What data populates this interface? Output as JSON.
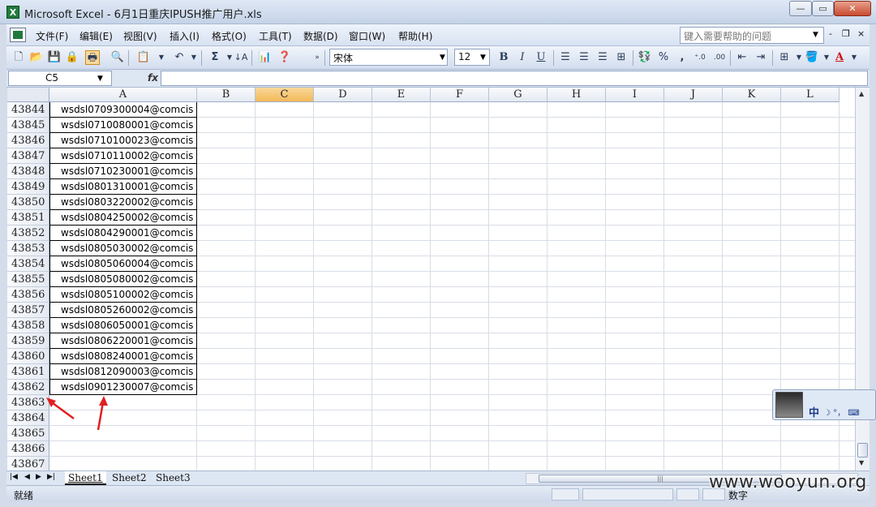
{
  "window": {
    "title": "Microsoft Excel - 6月1日重庆IPUSH推广用户.xls",
    "app_icon": "excel-icon",
    "controls": {
      "minimize": "—",
      "maximize": "▭",
      "close": "✕"
    }
  },
  "menu": {
    "items": [
      "文件(F)",
      "编辑(E)",
      "视图(V)",
      "插入(I)",
      "格式(O)",
      "工具(T)",
      "数据(D)",
      "窗口(W)",
      "帮助(H)"
    ],
    "help_placeholder": "键入需要帮助的问题",
    "mdi": {
      "min": "-",
      "restore": "❐",
      "close": "×"
    }
  },
  "toolbar": {
    "font_name": "宋体",
    "font_size": "12",
    "sum_symbol": "Σ",
    "bold": "B",
    "italic": "I",
    "underline": "U",
    "percent": "%",
    "comma": ",",
    "inc_dec": "⁺.0",
    "dec_dec": ".00",
    "font_color": "A"
  },
  "formula_bar": {
    "name_box": "C5",
    "fx": "fx",
    "value": ""
  },
  "grid": {
    "columns": [
      "A",
      "B",
      "C",
      "D",
      "E",
      "F",
      "G",
      "H",
      "I",
      "J",
      "K",
      "L"
    ],
    "active_column": "C",
    "rows": [
      {
        "num": "43844",
        "a": "wsdsl0709300004@comcis"
      },
      {
        "num": "43845",
        "a": "wsdsl0710080001@comcis"
      },
      {
        "num": "43846",
        "a": "wsdsl0710100023@comcis"
      },
      {
        "num": "43847",
        "a": "wsdsl0710110002@comcis"
      },
      {
        "num": "43848",
        "a": "wsdsl0710230001@comcis"
      },
      {
        "num": "43849",
        "a": "wsdsl0801310001@comcis"
      },
      {
        "num": "43850",
        "a": "wsdsl0803220002@comcis"
      },
      {
        "num": "43851",
        "a": "wsdsl0804250002@comcis"
      },
      {
        "num": "43852",
        "a": "wsdsl0804290001@comcis"
      },
      {
        "num": "43853",
        "a": "wsdsl0805030002@comcis"
      },
      {
        "num": "43854",
        "a": "wsdsl0805060004@comcis"
      },
      {
        "num": "43855",
        "a": "wsdsl0805080002@comcis"
      },
      {
        "num": "43856",
        "a": "wsdsl0805100002@comcis"
      },
      {
        "num": "43857",
        "a": "wsdsl0805260002@comcis"
      },
      {
        "num": "43858",
        "a": "wsdsl0806050001@comcis"
      },
      {
        "num": "43859",
        "a": "wsdsl0806220001@comcis"
      },
      {
        "num": "43860",
        "a": "wsdsl0808240001@comcis"
      },
      {
        "num": "43861",
        "a": "wsdsl0812090003@comcis"
      },
      {
        "num": "43862",
        "a": "wsdsl0901230007@comcis"
      },
      {
        "num": "43863",
        "a": ""
      },
      {
        "num": "43864",
        "a": ""
      },
      {
        "num": "43865",
        "a": ""
      },
      {
        "num": "43866",
        "a": ""
      },
      {
        "num": "43867",
        "a": ""
      }
    ]
  },
  "sheets": [
    "Sheet1",
    "Sheet2",
    "Sheet3"
  ],
  "active_sheet": "Sheet1",
  "sheet_nav": [
    "|◀",
    "◀",
    "▶",
    "▶|"
  ],
  "status": {
    "text": "就绪",
    "mode": "数字"
  },
  "ime": {
    "lang": "中",
    "tools": "☽ °， ⌨"
  },
  "watermark": "www.wooyun.org",
  "colors": {
    "active_header": "#f2b857",
    "arrow": "#e02020"
  }
}
